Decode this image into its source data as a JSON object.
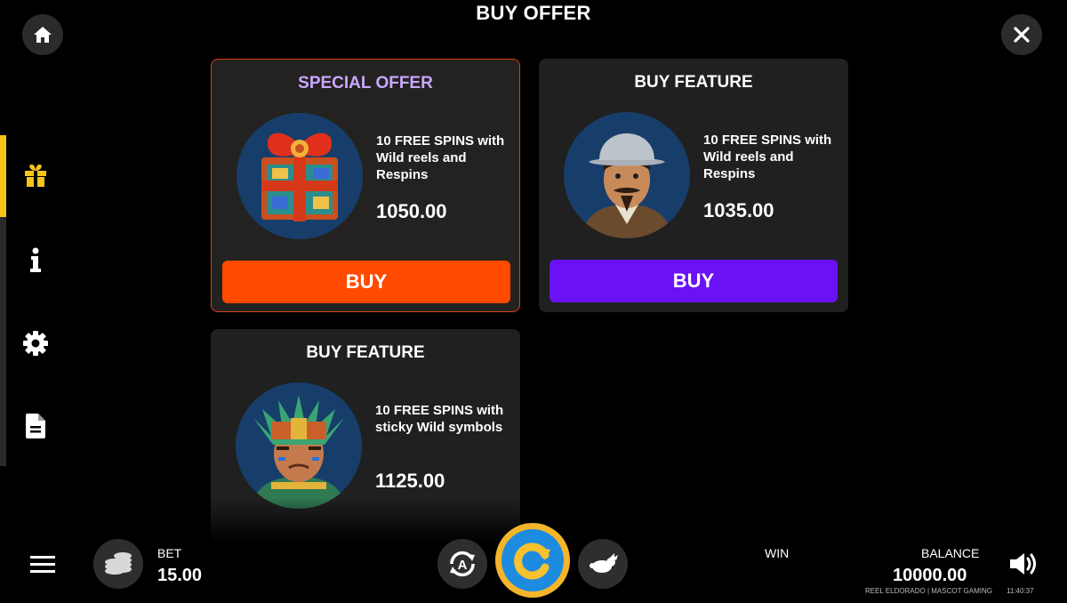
{
  "header": {
    "title": "BUY OFFER"
  },
  "icons": {
    "home": "home-icon",
    "close": "close-icon",
    "gift": "gift-icon",
    "info": "info-icon",
    "settings": "gear-icon",
    "paytable": "document-icon",
    "menu": "hamburger-icon",
    "bet": "coins-icon",
    "autoplay": "autoplay-icon",
    "spin": "spin-icon",
    "turbo": "rabbit-icon",
    "sound": "speaker-icon"
  },
  "colors": {
    "accent_yellow": "#f5c518",
    "special_title": "#c9a7ff",
    "buy_orange": "#ff4a00",
    "buy_purple": "#6a11f5",
    "card_bg": "#202020"
  },
  "offers": [
    {
      "title": "SPECIAL OFFER",
      "description": "10 FREE SPINS with Wild reels and Respins",
      "price": "1050.00",
      "button": "BUY",
      "image": "gift box"
    },
    {
      "title": "BUY FEATURE",
      "description": "10 FREE SPINS with Wild reels and Respins",
      "price": "1035.00",
      "button": "BUY",
      "image": "conquistador"
    },
    {
      "title": "BUY FEATURE",
      "description": "10 FREE SPINS with sticky Wild symbols",
      "price": "1125.00",
      "image": "aztec warrior"
    }
  ],
  "footer": {
    "bet_label": "BET",
    "bet_value": "15.00",
    "win_label": "WIN",
    "balance_label": "BALANCE",
    "balance_value": "10000.00",
    "credits": "REEL ELDORADO | MASCOT GAMING",
    "time": "11:40:37"
  }
}
